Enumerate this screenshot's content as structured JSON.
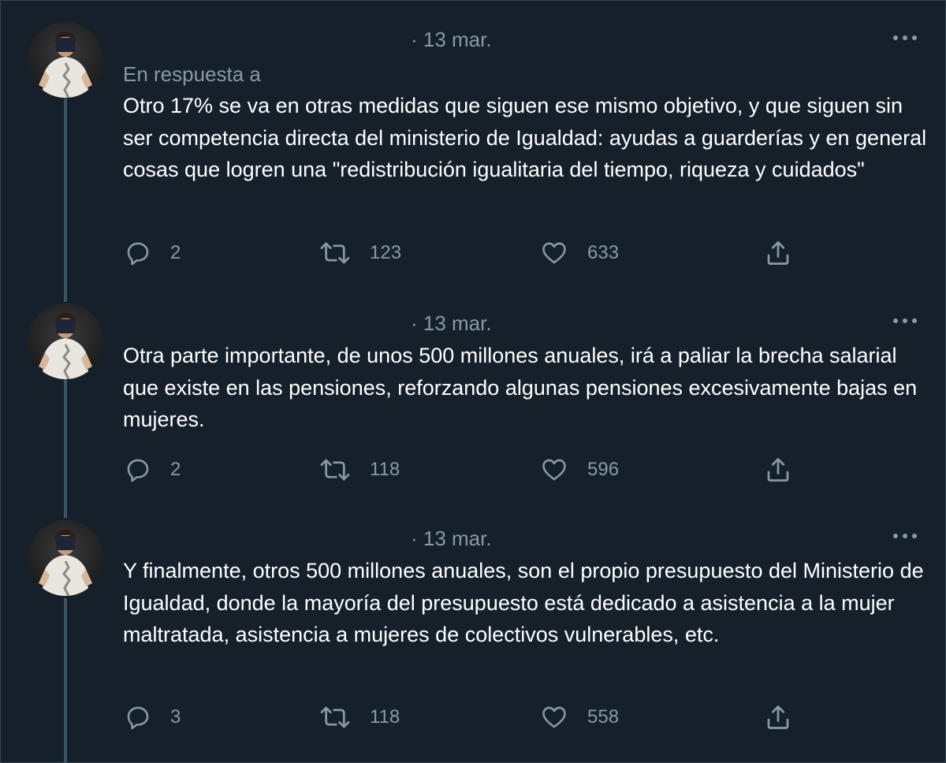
{
  "tweets": [
    {
      "date": "· 13 mar.",
      "reply_to": "En respuesta a",
      "text": "Otro 17% se va en otras medidas que siguen ese mismo objetivo, y que siguen sin ser competencia directa del ministerio de Igualdad: ayudas a guarderías y en general  cosas que logren una \"redistribución igualitaria del tiempo, riqueza y cuidados\"",
      "replies": "2",
      "retweets": "123",
      "likes": "633"
    },
    {
      "date": "· 13 mar.",
      "text": "Otra parte importante, de unos 500 millones anuales, irá a paliar la brecha salarial que existe en las pensiones, reforzando algunas pensiones excesivamente bajas en mujeres.",
      "replies": "2",
      "retweets": "118",
      "likes": "596"
    },
    {
      "date": "· 13 mar.",
      "text": "Y finalmente, otros 500 millones anuales, son el propio presupuesto del Ministerio de Igualdad, donde la mayoría del presupuesto está dedicado a asistencia a la mujer maltratada, asistencia a mujeres de colectivos vulnerables, etc.",
      "replies": "3",
      "retweets": "118",
      "likes": "558"
    }
  ],
  "icons": {
    "more": "more-horizontal-icon",
    "reply": "reply-icon",
    "retweet": "retweet-icon",
    "like": "heart-icon",
    "share": "share-icon"
  },
  "colors": {
    "background": "#15202b",
    "secondary_text": "#8b98a5",
    "thread_line": "#3d5466"
  }
}
